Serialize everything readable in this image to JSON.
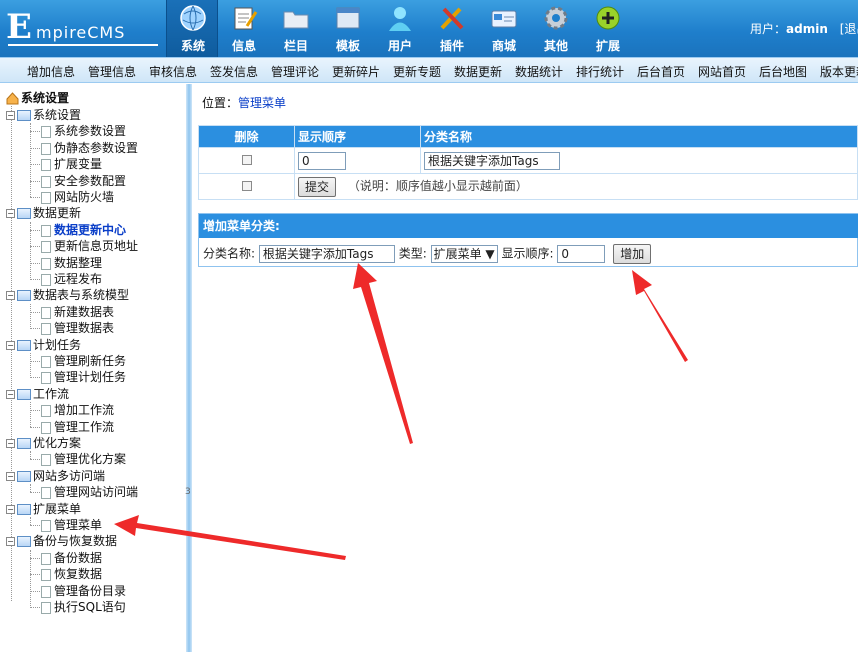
{
  "header": {
    "logo_letter": "E",
    "logo_rest": "mpireCMS",
    "nav": [
      {
        "label": "系统",
        "icon": "globe-icon",
        "active": true
      },
      {
        "label": "信息",
        "icon": "notepad-icon"
      },
      {
        "label": "栏目",
        "icon": "folder-icon"
      },
      {
        "label": "模板",
        "icon": "window-icon"
      },
      {
        "label": "用户",
        "icon": "user-icon"
      },
      {
        "label": "插件",
        "icon": "tools-icon"
      },
      {
        "label": "商城",
        "icon": "card-icon"
      },
      {
        "label": "其他",
        "icon": "gear-icon"
      },
      {
        "label": "扩展",
        "icon": "plus-circle-icon"
      }
    ],
    "user_label": "用户：",
    "user_name": "admin",
    "logout": "[退出"
  },
  "subnav": [
    "增加信息",
    "管理信息",
    "审核信息",
    "签发信息",
    "管理评论",
    "更新碎片",
    "更新专题",
    "数据更新",
    "数据统计",
    "排行统计",
    "后台首页",
    "网站首页",
    "后台地图",
    "版本更新"
  ],
  "sidebar": {
    "root": "系统设置",
    "groups": [
      {
        "label": "系统设置",
        "items": [
          "系统参数设置",
          "伪静态参数设置",
          "扩展变量",
          "安全参数配置",
          "网站防火墙"
        ]
      },
      {
        "label": "数据更新",
        "items": [
          "数据更新中心",
          "更新信息页地址",
          "数据整理",
          "远程发布"
        ]
      },
      {
        "label": "数据表与系统模型",
        "items": [
          "新建数据表",
          "管理数据表"
        ]
      },
      {
        "label": "计划任务",
        "items": [
          "管理刷新任务",
          "管理计划任务"
        ]
      },
      {
        "label": "工作流",
        "items": [
          "增加工作流",
          "管理工作流"
        ]
      },
      {
        "label": "优化方案",
        "items": [
          "管理优化方案"
        ]
      },
      {
        "label": "网站多访问端",
        "items": [
          "管理网站访问端"
        ]
      },
      {
        "label": "扩展菜单",
        "items": [
          "管理菜单"
        ]
      },
      {
        "label": "备份与恢复数据",
        "items": [
          "备份数据",
          "恢复数据",
          "管理备份目录",
          "执行SQL语句"
        ]
      }
    ],
    "selected": "数据更新中心",
    "divider_mark": "3"
  },
  "main": {
    "crumb_label": "位置：",
    "crumb_link": "管理菜单",
    "table": {
      "headers": [
        "删除",
        "显示顺序",
        "分类名称"
      ],
      "row": {
        "order": "0",
        "name": "根据关键字添加Tags"
      },
      "submit": "提交",
      "note": "（说明：顺序值越小显示越前面）"
    },
    "add": {
      "title": "增加菜单分类:",
      "name_label": "分类名称:",
      "name_value": "根据关键字添加Tags",
      "type_label": "类型:",
      "type_value": "扩展菜单",
      "order_label": "显示顺序:",
      "order_value": "0",
      "button": "增加"
    }
  },
  "colors": {
    "header": "#1f7fcc",
    "accent": "#2b8fe0",
    "arrow": "#ee2a2a",
    "link": "#0a3ec8"
  }
}
